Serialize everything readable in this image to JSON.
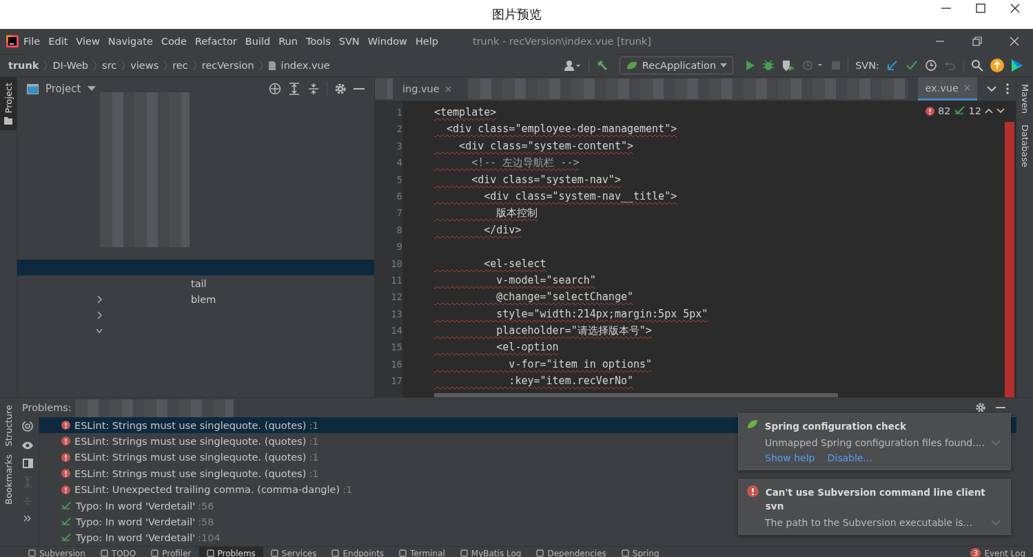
{
  "viewer": {
    "title": "图片预览"
  },
  "menu": [
    "File",
    "Edit",
    "View",
    "Navigate",
    "Code",
    "Refactor",
    "Build",
    "Run",
    "Tools",
    "SVN",
    "Window",
    "Help"
  ],
  "window_title": "trunk - recVersion\\index.vue [trunk]",
  "breadcrumbs": [
    "trunk",
    "DI-Web",
    "src",
    "views",
    "rec",
    "recVersion",
    "index.vue"
  ],
  "run_config": "RecApplication",
  "svn_label": "SVN:",
  "left_stripe": [
    {
      "label": "Project",
      "selected": true
    }
  ],
  "left_stripe_bottom": [
    "Structure",
    "Bookmarks"
  ],
  "right_stripe": [
    "Maven",
    "Database"
  ],
  "project_panel": {
    "title": "Project",
    "rows": [
      {
        "selected": true
      },
      {
        "label": "tail",
        "selected": false
      },
      {
        "label": "blem",
        "selected": false,
        "expanded": false
      },
      {
        "selected": false,
        "expanded": false
      },
      {
        "selected": false,
        "expanded": true
      }
    ]
  },
  "editor_tabs": [
    {
      "label": "ing.vue",
      "selected": false
    },
    {
      "label": "ex.vue",
      "selected": true
    }
  ],
  "inspections": {
    "errors": "82",
    "typos": "12"
  },
  "code": [
    {
      "n": "1",
      "text": "<template>"
    },
    {
      "n": "2",
      "text": "  <div class=\"employee-dep-management\">"
    },
    {
      "n": "3",
      "text": "    <div class=\"system-content\">"
    },
    {
      "n": "4",
      "text": "      <!-- 左边导航栏 -->",
      "kind": "comment"
    },
    {
      "n": "5",
      "text": "      <div class=\"system-nav\">"
    },
    {
      "n": "6",
      "text": "        <div class=\"system-nav__title\">"
    },
    {
      "n": "7",
      "text": "          版本控制"
    },
    {
      "n": "8",
      "text": "        </div>"
    },
    {
      "n": "9"
    },
    {
      "n": "10",
      "text": "        <el-select"
    },
    {
      "n": "11",
      "text": "          v-model=\"search\""
    },
    {
      "n": "12",
      "text": "          @change=\"selectChange\""
    },
    {
      "n": "13",
      "text": "          style=\"width:214px;margin:5px 5px\""
    },
    {
      "n": "14",
      "text": "          placeholder=\"请选择版本号\">"
    },
    {
      "n": "15",
      "text": "          <el-option"
    },
    {
      "n": "16",
      "text": "            v-for=\"item in options\""
    },
    {
      "n": "17",
      "text": "            :key=\"item.recVerNo\""
    }
  ],
  "problems": {
    "title": "Problems:",
    "items": [
      {
        "kind": "error",
        "text": "ESLint: Strings must use singlequote. (quotes)",
        "line": ":1",
        "selected": true
      },
      {
        "kind": "error",
        "text": "ESLint: Strings must use singlequote. (quotes)",
        "line": ":1",
        "selected": false
      },
      {
        "kind": "error",
        "text": "ESLint: Strings must use singlequote. (quotes)",
        "line": ":1",
        "selected": false
      },
      {
        "kind": "error",
        "text": "ESLint: Strings must use singlequote. (quotes)",
        "line": ":1",
        "selected": false
      },
      {
        "kind": "error",
        "text": "ESLint: Unexpected trailing comma. (comma-dangle)",
        "line": ":1",
        "selected": false
      },
      {
        "kind": "typo",
        "text": "Typo: In word 'Verdetail'",
        "line": ":56",
        "selected": false
      },
      {
        "kind": "typo",
        "text": "Typo: In word 'Verdetail'",
        "line": ":58",
        "selected": false
      },
      {
        "kind": "typo",
        "text": "Typo: In word 'Verdetail'",
        "line": ":104",
        "selected": false
      }
    ]
  },
  "notifications": [
    {
      "kind": "spring",
      "title": "Spring configuration check",
      "body": "Unmapped Spring configuration files found....",
      "links": [
        "Show help",
        "Disable..."
      ]
    },
    {
      "kind": "error",
      "title": "Can't use Subversion command line client svn",
      "body": "The path to the Subversion executable is..."
    }
  ],
  "bottom_tabs": [
    {
      "label": "Subversion",
      "selected": false
    },
    {
      "label": "TODO",
      "selected": false
    },
    {
      "label": "Profiler",
      "selected": false
    },
    {
      "label": "Problems",
      "selected": true
    },
    {
      "label": "Services",
      "selected": false
    },
    {
      "label": "Endpoints",
      "selected": false
    },
    {
      "label": "Terminal",
      "selected": false
    },
    {
      "label": "MyBatis Log",
      "selected": false
    },
    {
      "label": "Dependencies",
      "selected": false
    },
    {
      "label": "Spring",
      "selected": false
    }
  ],
  "event_log": {
    "label": "Event Log",
    "badge": "3"
  }
}
